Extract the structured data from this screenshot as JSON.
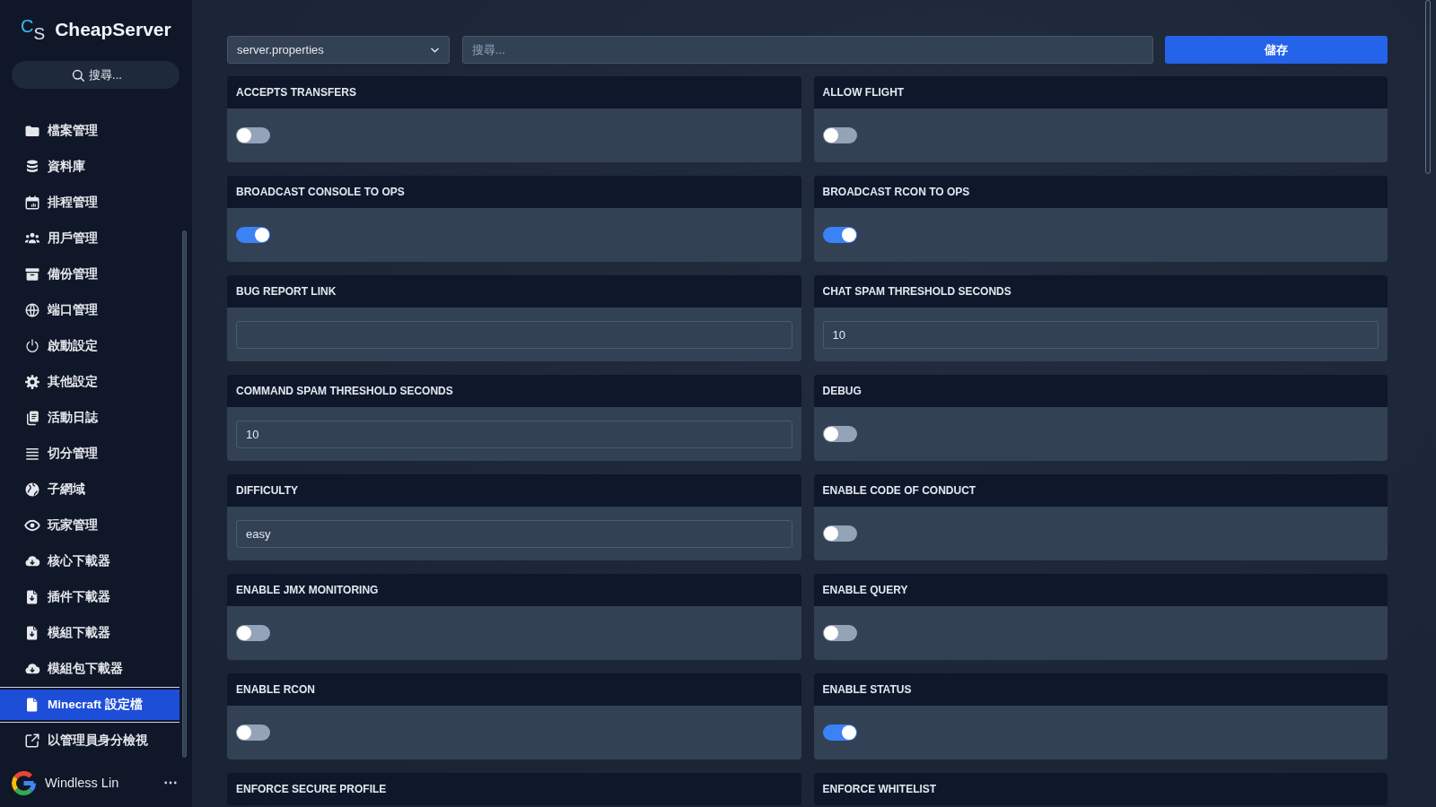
{
  "brand": {
    "mark": "C$_{S}$",
    "name": "CheapServer"
  },
  "sidebar": {
    "search": {
      "placeholder": "搜尋..."
    },
    "items": [
      {
        "label": "檔案管理",
        "selected": false
      },
      {
        "label": "資料庫",
        "selected": false
      },
      {
        "label": "排程管理",
        "selected": false
      },
      {
        "label": "用戶管理",
        "selected": false
      },
      {
        "label": "備份管理",
        "selected": false
      },
      {
        "label": "端口管理",
        "selected": false
      },
      {
        "label": "啟動設定",
        "selected": false
      },
      {
        "label": "其他設定",
        "selected": false
      },
      {
        "label": "活動日誌",
        "selected": false
      },
      {
        "label": "切分管理",
        "selected": false
      },
      {
        "label": "子網域",
        "selected": false
      },
      {
        "label": "玩家管理",
        "selected": false
      },
      {
        "label": "核心下載器",
        "selected": false
      },
      {
        "label": "插件下載器",
        "selected": false
      },
      {
        "label": "模組下載器",
        "selected": false
      },
      {
        "label": "模組包下載器",
        "selected": false
      },
      {
        "label": "Minecraft 設定檔",
        "selected": true
      },
      {
        "label": "以管理員身分檢視",
        "selected": false
      }
    ]
  },
  "user": {
    "name": "Windless Lin"
  },
  "toolbar": {
    "file_select": {
      "value": "server.properties"
    },
    "search": {
      "placeholder": "搜尋..."
    },
    "save_button": "儲存"
  },
  "settings": [
    {
      "label": "ACCEPTS TRANSFERS",
      "kind": "toggle",
      "on": false
    },
    {
      "label": "ALLOW FLIGHT",
      "kind": "toggle",
      "on": false
    },
    {
      "label": "BROADCAST CONSOLE TO OPS",
      "kind": "toggle",
      "on": true
    },
    {
      "label": "BROADCAST RCON TO OPS",
      "kind": "toggle",
      "on": true
    },
    {
      "label": "BUG REPORT LINK",
      "kind": "text"
    },
    {
      "label": "CHAT SPAM THRESHOLD SECONDS",
      "kind": "text",
      "value": "10"
    },
    {
      "label": "COMMAND SPAM THRESHOLD SECONDS",
      "kind": "text",
      "value": "10"
    },
    {
      "label": "DEBUG",
      "kind": "toggle",
      "on": false
    },
    {
      "label": "DIFFICULTY",
      "kind": "text",
      "value": "easy"
    },
    {
      "label": "ENABLE CODE OF CONDUCT",
      "kind": "toggle",
      "on": false
    },
    {
      "label": "ENABLE JMX MONITORING",
      "kind": "toggle",
      "on": false
    },
    {
      "label": "ENABLE QUERY",
      "kind": "toggle",
      "on": false
    },
    {
      "label": "ENABLE RCON",
      "kind": "toggle",
      "on": false
    },
    {
      "label": "ENABLE STATUS",
      "kind": "toggle",
      "on": true
    },
    {
      "label": "ENFORCE SECURE PROFILE"
    },
    {
      "label": "ENFORCE WHITELIST"
    }
  ]
}
